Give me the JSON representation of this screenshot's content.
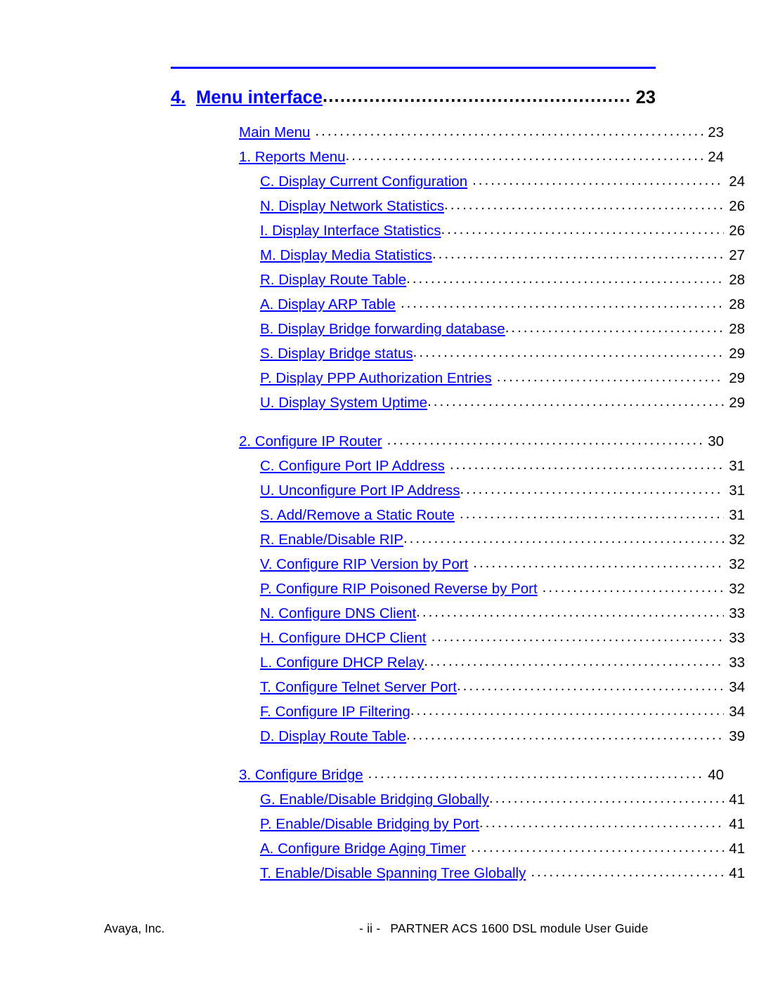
{
  "document": {
    "title": "PARTNER ACS 1600 DSL module User Guide",
    "section_color": "#0000FF",
    "rule_color": "#0000FF"
  },
  "toc": {
    "heading": {
      "number": "4.",
      "label": "Menu interface",
      "page": "23"
    },
    "entries": [
      {
        "level": 2,
        "label": "Main Menu",
        "page": "23",
        "space_before_leader": true,
        "group_gap": false
      },
      {
        "level": 2,
        "label": "1. Reports Menu",
        "page": "24",
        "space_before_leader": false,
        "group_gap": false
      },
      {
        "level": 3,
        "label": "C. Display Current Configuration",
        "page": "24",
        "space_before_leader": true,
        "group_gap": false
      },
      {
        "level": 3,
        "label": "N. Display Network Statistics",
        "page": "26",
        "space_before_leader": false,
        "group_gap": false
      },
      {
        "level": 3,
        "label": "I. Display Interface Statistics",
        "page": "26",
        "space_before_leader": false,
        "group_gap": false
      },
      {
        "level": 3,
        "label": "M. Display Media Statistics",
        "page": "27",
        "space_before_leader": false,
        "group_gap": false
      },
      {
        "level": 3,
        "label": "R. Display Route Table",
        "page": "28",
        "space_before_leader": false,
        "group_gap": false
      },
      {
        "level": 3,
        "label": "A. Display ARP Table",
        "page": "28",
        "space_before_leader": true,
        "group_gap": false
      },
      {
        "level": 3,
        "label": "B. Display Bridge forwarding database",
        "page": "28",
        "space_before_leader": false,
        "group_gap": false
      },
      {
        "level": 3,
        "label": "S. Display Bridge status",
        "page": "29",
        "space_before_leader": false,
        "group_gap": false
      },
      {
        "level": 3,
        "label": "P. Display PPP Authorization Entries",
        "page": "29",
        "space_before_leader": true,
        "group_gap": false
      },
      {
        "level": 3,
        "label": "U. Display System Uptime",
        "page": "29",
        "space_before_leader": false,
        "group_gap": false
      },
      {
        "level": 2,
        "label": "2. Configure IP Router",
        "page": "30",
        "space_before_leader": true,
        "group_gap": true
      },
      {
        "level": 3,
        "label": "C. Configure Port IP Address",
        "page": "31",
        "space_before_leader": true,
        "group_gap": false
      },
      {
        "level": 3,
        "label": "U. Unconfigure Port IP Address",
        "page": "31",
        "space_before_leader": false,
        "group_gap": false
      },
      {
        "level": 3,
        "label": "S. Add/Remove a Static Route",
        "page": "31",
        "space_before_leader": true,
        "group_gap": false
      },
      {
        "level": 3,
        "label": "R. Enable/Disable RIP",
        "page": "32",
        "space_before_leader": false,
        "group_gap": false
      },
      {
        "level": 3,
        "label": "V. Configure RIP Version by Port",
        "page": "32",
        "space_before_leader": true,
        "group_gap": false
      },
      {
        "level": 3,
        "label": "P. Configure RIP Poisoned Reverse by Port",
        "page": "32",
        "space_before_leader": true,
        "group_gap": false
      },
      {
        "level": 3,
        "label": "N. Configure DNS Client",
        "page": "33",
        "space_before_leader": false,
        "group_gap": false
      },
      {
        "level": 3,
        "label": "H. Configure DHCP Client",
        "page": "33",
        "space_before_leader": true,
        "group_gap": false
      },
      {
        "level": 3,
        "label": "L. Configure DHCP Relay",
        "page": "33",
        "space_before_leader": false,
        "group_gap": false
      },
      {
        "level": 3,
        "label": "T. Configure Telnet Server Port",
        "page": "34",
        "space_before_leader": false,
        "group_gap": false
      },
      {
        "level": 3,
        "label": "F. Configure IP Filtering",
        "page": "34",
        "space_before_leader": false,
        "group_gap": false
      },
      {
        "level": 3,
        "label": "D. Display Route Table",
        "page": "39",
        "space_before_leader": false,
        "group_gap": false
      },
      {
        "level": 2,
        "label": "3. Configure Bridge",
        "page": "40",
        "space_before_leader": true,
        "group_gap": true
      },
      {
        "level": 3,
        "label": "G. Enable/Disable Bridging Globally",
        "page": "41",
        "space_before_leader": false,
        "group_gap": false
      },
      {
        "level": 3,
        "label": "P. Enable/Disable Bridging by Port",
        "page": "41",
        "space_before_leader": false,
        "group_gap": false
      },
      {
        "level": 3,
        "label": "A. Configure Bridge Aging Timer",
        "page": "41",
        "space_before_leader": true,
        "group_gap": false
      },
      {
        "level": 3,
        "label": "T. Enable/Disable Spanning Tree Globally",
        "page": "41",
        "space_before_leader": true,
        "group_gap": false
      }
    ]
  },
  "footer": {
    "left": "Avaya, Inc.",
    "page_mark": "- ii -",
    "title": "PARTNER ACS 1600 DSL module User Guide"
  }
}
